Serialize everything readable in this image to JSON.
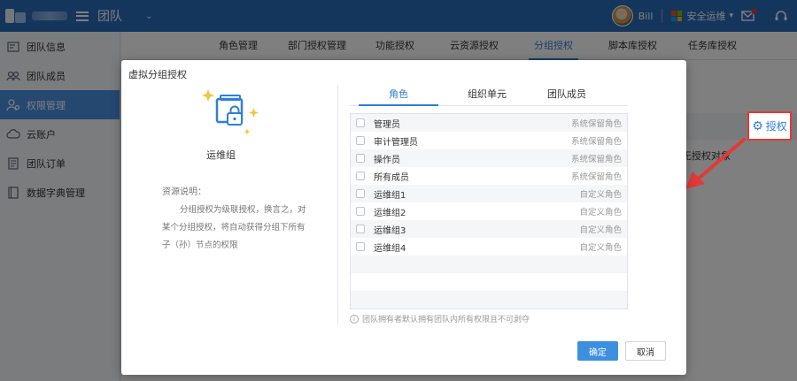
{
  "header": {
    "team_title": "团队",
    "username": "Bill",
    "product": "安全运维",
    "colors": {
      "bar": "#2b6cb8"
    }
  },
  "sidebar": {
    "items": [
      {
        "label": "团队信息",
        "icon": "id-card-icon",
        "active": false
      },
      {
        "label": "团队成员",
        "icon": "users-icon",
        "active": false
      },
      {
        "label": "权限管理",
        "icon": "user-key-icon",
        "active": true
      },
      {
        "label": "云账户",
        "icon": "cloud-icon",
        "active": false
      },
      {
        "label": "团队订单",
        "icon": "order-icon",
        "active": false
      },
      {
        "label": "数据字典管理",
        "icon": "book-icon",
        "active": false
      }
    ]
  },
  "tabs": [
    {
      "label": "角色管理",
      "active": false
    },
    {
      "label": "部门授权管理",
      "active": false
    },
    {
      "label": "功能授权",
      "active": false
    },
    {
      "label": "云资源授权",
      "active": false
    },
    {
      "label": "分组授权",
      "active": true
    },
    {
      "label": "脚本库授权",
      "active": false
    },
    {
      "label": "任务库授权",
      "active": false
    }
  ],
  "background": {
    "fragment": "无授权对象",
    "authorize_label": "授权"
  },
  "modal": {
    "title": "虚拟分组授权",
    "group_name": "运维组",
    "resource_label": "资源说明：",
    "resource_desc": "分组授权为级联授权，换言之，对某个分组授权，将自动获得分组下所有子（孙）节点的权限",
    "tabs": [
      {
        "label": "角色",
        "active": true
      },
      {
        "label": "组织单元",
        "active": false
      },
      {
        "label": "团队成员",
        "active": false
      }
    ],
    "roles": [
      {
        "name": "管理员",
        "type": "系统保留角色"
      },
      {
        "name": "审计管理员",
        "type": "系统保留角色"
      },
      {
        "name": "操作员",
        "type": "系统保留角色"
      },
      {
        "name": "所有成员",
        "type": "系统保留角色"
      },
      {
        "name": "运维组1",
        "type": "自定义角色"
      },
      {
        "name": "运维组2",
        "type": "自定义角色"
      },
      {
        "name": "运维组3",
        "type": "自定义角色"
      },
      {
        "name": "运维组4",
        "type": "自定义角色"
      }
    ],
    "note": "团队拥有者默认拥有团队内所有权限且不可剥夺",
    "ok_label": "确定",
    "cancel_label": "取消",
    "colors": {
      "accent": "#2f7fd6",
      "primary_button": "#3d8fe0"
    }
  }
}
